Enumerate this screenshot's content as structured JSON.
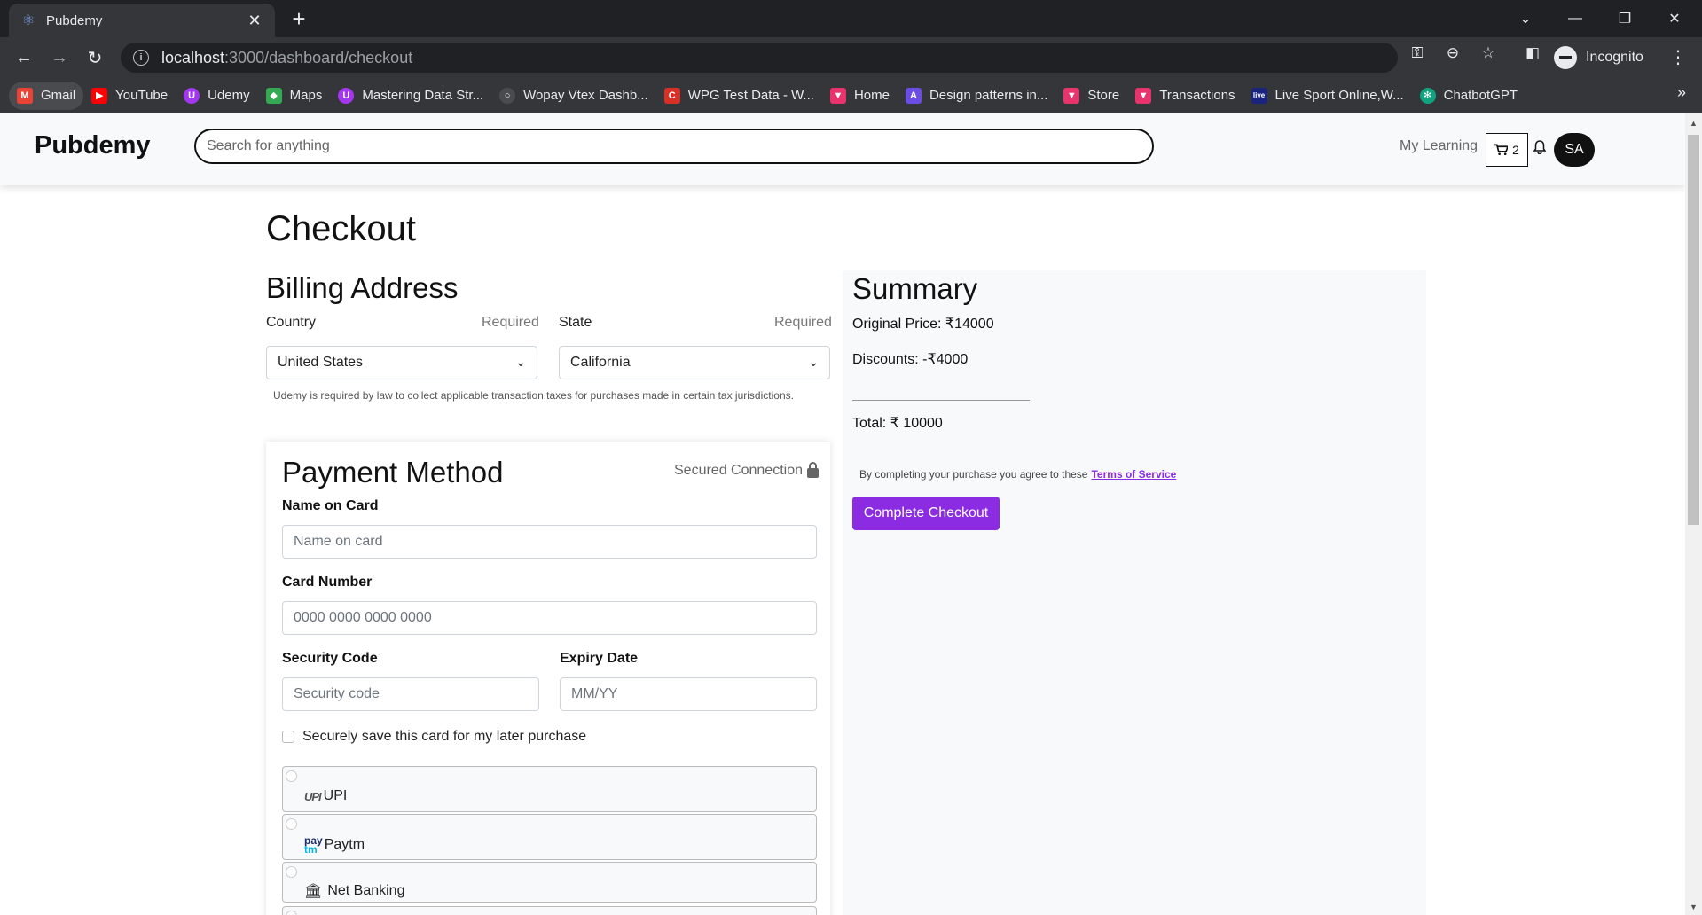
{
  "browser": {
    "tab_title": "Pubdemy",
    "url_host": "localhost",
    "url_rest": ":3000/dashboard/checkout",
    "profile_label": "Incognito",
    "bookmarks": [
      {
        "label": "Gmail",
        "icon": "gmail-icon",
        "color": "#ea4335"
      },
      {
        "label": "YouTube",
        "icon": "youtube-icon",
        "color": "#ff0000"
      },
      {
        "label": "Udemy",
        "icon": "udemy-icon",
        "color": "#a435f0"
      },
      {
        "label": "Maps",
        "icon": "maps-icon",
        "color": "#34a853"
      },
      {
        "label": "Mastering Data Str...",
        "icon": "udemy-icon",
        "color": "#a435f0"
      },
      {
        "label": "Wopay Vtex Dashb...",
        "icon": "globe-icon",
        "color": "#5f6368"
      },
      {
        "label": "WPG Test Data - W...",
        "icon": "c-icon",
        "color": "#d93025"
      },
      {
        "label": "Home",
        "icon": "v-icon",
        "color": "#e8336d"
      },
      {
        "label": "Design patterns in...",
        "icon": "a-icon",
        "color": "#6b4ce6"
      },
      {
        "label": "Store",
        "icon": "v-icon",
        "color": "#e8336d"
      },
      {
        "label": "Transactions",
        "icon": "v-icon",
        "color": "#e8336d"
      },
      {
        "label": "Live Sport Online,W...",
        "icon": "live-icon",
        "color": "#1a237e"
      },
      {
        "label": "ChatbotGPT",
        "icon": "chatgpt-icon",
        "color": "#10a37f"
      }
    ]
  },
  "header": {
    "brand": "Pubdemy",
    "search_placeholder": "Search for anything",
    "my_learning": "My Learning",
    "cart_count": "2",
    "avatar_initials": "SA"
  },
  "checkout": {
    "title": "Checkout",
    "billing_title": "Billing Address",
    "country_label": "Country",
    "state_label": "State",
    "required_label": "Required",
    "country_value": "United States",
    "state_value": "California",
    "tax_note": "Udemy is required by law to collect applicable transaction taxes for purchases made in certain tax jurisdictions."
  },
  "payment": {
    "title": "Payment Method",
    "secured_label": "Secured Connection",
    "name_label": "Name on Card",
    "name_placeholder": "Name on card",
    "number_label": "Card Number",
    "number_placeholder": "0000 0000 0000 0000",
    "security_label": "Security Code",
    "security_placeholder": "Security code",
    "expiry_label": "Expiry Date",
    "expiry_placeholder": "MM/YY",
    "save_card_label": "Securely save this card for my later purchase",
    "options": [
      {
        "label": "UPI",
        "logo": "UPI"
      },
      {
        "label": "Paytm",
        "logo_top": "pay",
        "logo_bottom": "tm"
      },
      {
        "label": "Net Banking"
      }
    ]
  },
  "summary": {
    "title": "Summary",
    "original_price": "Original Price: ₹14000",
    "discounts": "Discounts: -₹4000",
    "total": "Total: ₹ 10000",
    "terms_text": "By completing your purchase you agree to these",
    "terms_link": "Terms of Service",
    "button": "Complete Checkout",
    "accent_color": "#8b2be2"
  }
}
